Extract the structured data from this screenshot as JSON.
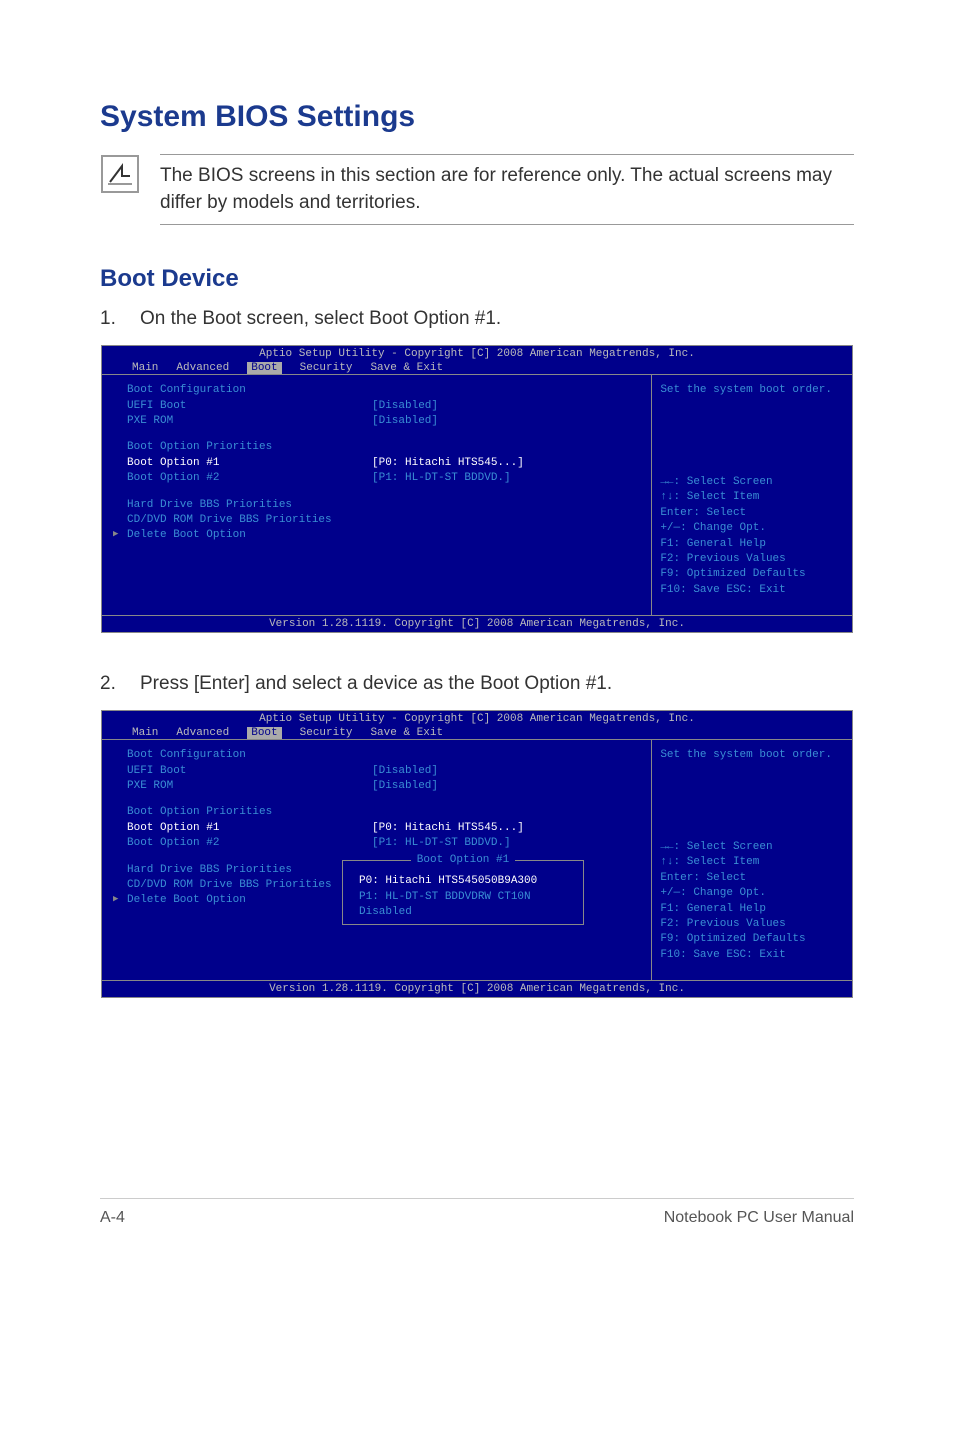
{
  "title": "System BIOS Settings",
  "note": "The BIOS screens in this section are for reference only. The actual screens may differ by models and territories.",
  "subtitle": "Boot Device",
  "step1_num": "1.",
  "step1_text": "On the Boot screen, select Boot Option #1.",
  "step2_num": "2.",
  "step2_text": "Press [Enter] and select a device as the Boot Option #1.",
  "bios": {
    "header": "Aptio Setup Utility - Copyright [C] 2008 American Megatrends, Inc.",
    "tabs": {
      "main": "Main",
      "advanced": "Advanced",
      "boot": "Boot",
      "security": "Security",
      "save_exit": "Save & Exit"
    },
    "left": {
      "boot_config": "Boot Configuration",
      "uefi_boot": "UEFI Boot",
      "uefi_boot_val": "[Disabled]",
      "pxe_rom": "PXE ROM",
      "pxe_rom_val": "[Disabled]",
      "boot_priorities": "Boot Option Priorities",
      "boot_opt1": "Boot Option #1",
      "boot_opt1_val": "[P0: Hitachi HTS545...]",
      "boot_opt2": "Boot Option #2",
      "boot_opt2_val": "[P1: HL-DT-ST BDDVD.]",
      "hdd_bbs": "Hard Drive BBS Priorities",
      "cddvd_bbs": "CD/DVD ROM Drive BBS Priorities",
      "delete_boot": "Delete Boot Option"
    },
    "right": {
      "help": "Set the system boot order.",
      "k1": "→←: Select Screen",
      "k2": "↑↓:    Select Item",
      "k3": "Enter: Select",
      "k4": "+/—:  Change Opt.",
      "k5": "F1:    General Help",
      "k6": "F2:    Previous Values",
      "k7": "F9:    Optimized Defaults",
      "k8": "F10:  Save   ESC: Exit"
    },
    "footer": "Version 1.28.1119. Copyright [C] 2008 American Megatrends, Inc.",
    "popup": {
      "title": "Boot Option #1",
      "item1": "P0: Hitachi HTS545050B9A300",
      "item2": "P1: HL-DT-ST BDDVDRW CT10N",
      "item3": "Disabled"
    }
  },
  "footer_left": "A-4",
  "footer_right": "Notebook PC User Manual"
}
